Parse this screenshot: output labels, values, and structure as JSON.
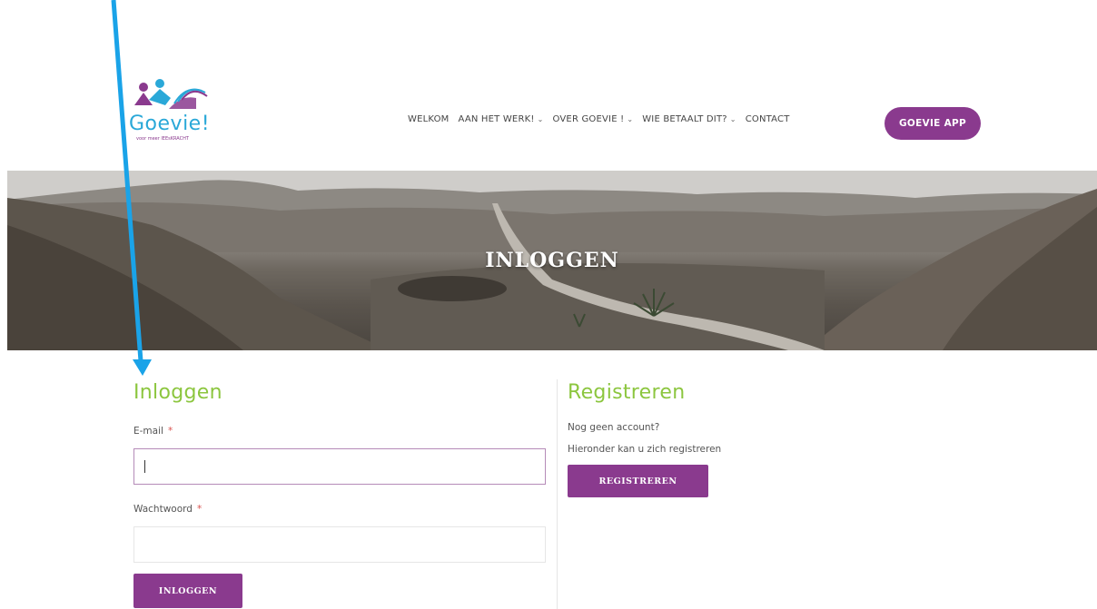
{
  "header": {
    "logo_text": "Goevie!",
    "logo_tagline": "voor meer lEEsKRACHT",
    "nav": [
      {
        "label": "WELKOM",
        "dropdown": false
      },
      {
        "label": "AAN HET WERK!",
        "dropdown": true
      },
      {
        "label": "OVER GOEVIE !",
        "dropdown": true
      },
      {
        "label": "WIE BETAALT DIT?",
        "dropdown": true
      },
      {
        "label": "CONTACT",
        "dropdown": false
      }
    ],
    "app_button": "GOEVIE APP"
  },
  "hero": {
    "title": "INLOGGEN"
  },
  "login": {
    "heading": "Inloggen",
    "email_label": "E-mail",
    "email_value": "",
    "password_label": "Wachtwoord",
    "password_value": "",
    "required_mark": "*",
    "submit": "INLOGGEN"
  },
  "register": {
    "heading": "Registreren",
    "line1": "Nog geen account?",
    "line2": "Hieronder kan u zich registreren",
    "button": "REGISTREREN"
  },
  "colors": {
    "brand_purple": "#8a3a8e",
    "heading_green": "#8cc63f",
    "annotation_arrow": "#1aa3e8"
  }
}
